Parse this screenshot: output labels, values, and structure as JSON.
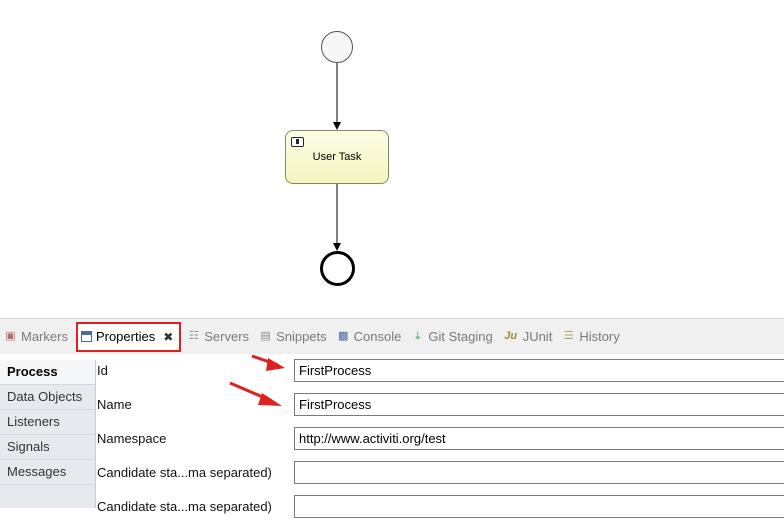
{
  "diagram": {
    "task_label": "User Task",
    "task_icon": "user-task-icon"
  },
  "tabs": [
    {
      "label": "Markers",
      "icon": "markers-icon"
    },
    {
      "label": "Properties",
      "icon": "properties-icon",
      "active": true
    },
    {
      "label": "Servers",
      "icon": "servers-icon"
    },
    {
      "label": "Snippets",
      "icon": "snippets-icon"
    },
    {
      "label": "Console",
      "icon": "console-icon"
    },
    {
      "label": "Git Staging",
      "icon": "git-staging-icon"
    },
    {
      "label": "JUnit",
      "icon": "junit-icon"
    },
    {
      "label": "History",
      "icon": "history-icon"
    }
  ],
  "sidebar": {
    "items": [
      {
        "label": "Process"
      },
      {
        "label": "Data Objects"
      },
      {
        "label": "Listeners"
      },
      {
        "label": "Signals"
      },
      {
        "label": "Messages"
      }
    ]
  },
  "properties": {
    "id_label": "Id",
    "id_value": "FirstProcess",
    "name_label": "Name",
    "name_value": "FirstProcess",
    "namespace_label": "Namespace",
    "namespace_value": "http://www.activiti.org/test",
    "candidate_users_label": "Candidate sta...ma separated)",
    "candidate_users_value": "",
    "candidate_groups_label": "Candidate sta...ma separated)",
    "candidate_groups_value": ""
  },
  "colors": {
    "highlight": "#e02020",
    "annotation_arrow": "#e02020"
  }
}
